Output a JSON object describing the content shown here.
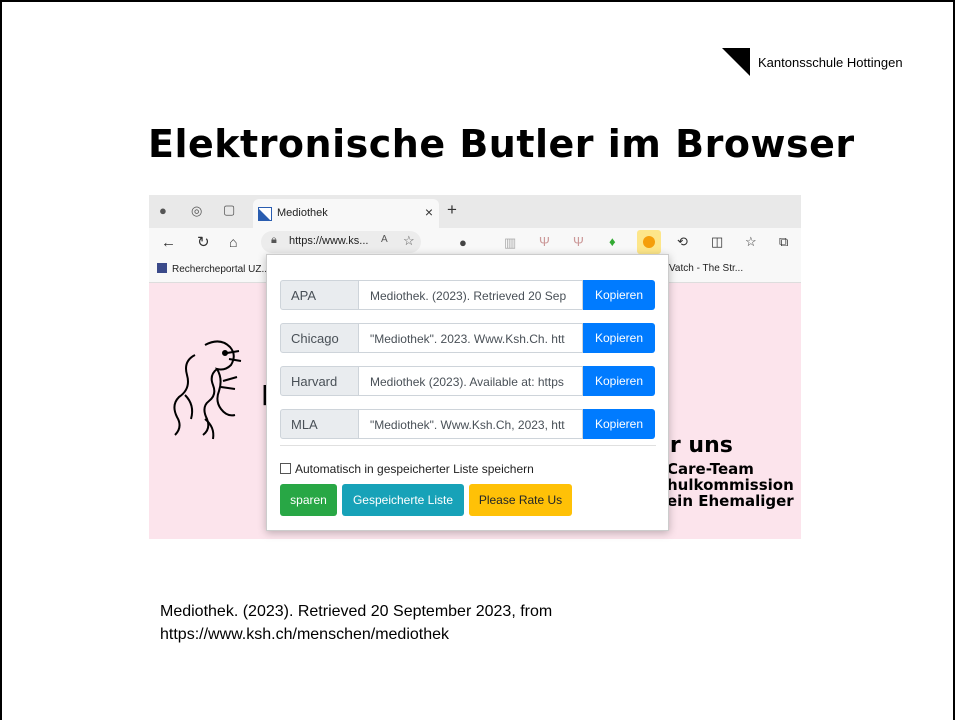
{
  "logo": {
    "text": "Kantonsschule Hottingen"
  },
  "slide": {
    "title": "Elektronische Butler im Browser"
  },
  "browser": {
    "tab_title": "Mediothek",
    "tab_close": "×",
    "new_tab": "+",
    "url": "https://www.ks...",
    "bookmarks": [
      "Rechercheportal UZ...",
      "Vatch - The Str..."
    ]
  },
  "page": {
    "heading_partial": "er uns",
    "links_partial": [
      "Care-Team",
      "hulkommission",
      "ein Ehemaliger"
    ]
  },
  "popup": {
    "rows": [
      {
        "format": "APA",
        "citation": "Mediothek. (2023). Retrieved 20 Sep",
        "button": "Kopieren"
      },
      {
        "format": "Chicago",
        "citation": "\"Mediothek\". 2023. Www.Ksh.Ch. htt",
        "button": "Kopieren"
      },
      {
        "format": "Harvard",
        "citation": "Mediothek (2023). Available at: https",
        "button": "Kopieren"
      },
      {
        "format": "MLA",
        "citation": "\"Mediothek\". Www.Ksh.Ch, 2023, htt",
        "button": "Kopieren"
      }
    ],
    "auto_save_label": "Automatisch in gespeicherter Liste speichern",
    "auto_save_checked": false,
    "save_button": "sparen",
    "saved_list_button": "Gespeicherte Liste",
    "rate_button": "Please Rate Us",
    "colors": {
      "copy": "#007bff",
      "save": "#28a745",
      "saved_list": "#17a2b8",
      "rate": "#ffc107"
    }
  },
  "caption": {
    "line1": "Mediothek. (2023). Retrieved 20 September 2023, from",
    "line2": "https://www.ksh.ch/menschen/mediothek"
  }
}
